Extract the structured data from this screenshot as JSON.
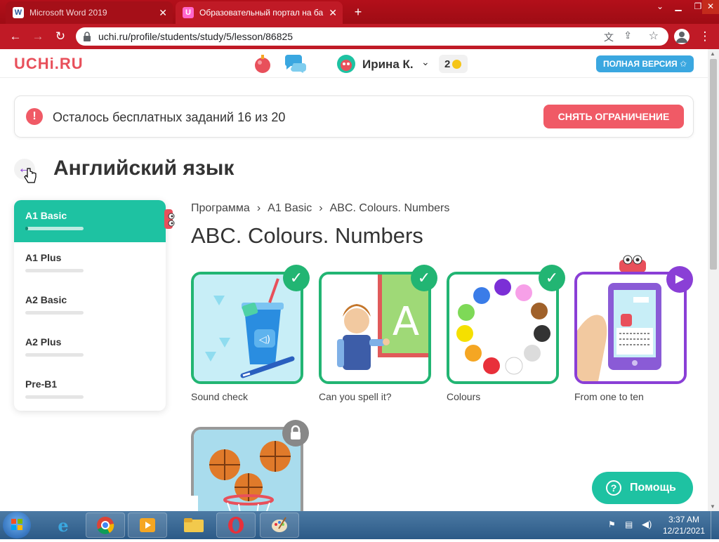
{
  "browser": {
    "tabs": [
      {
        "title": "Microsoft Word 2019",
        "favicon": "W"
      },
      {
        "title": "Образовательный портал на ба",
        "favicon": "U"
      }
    ],
    "url": "uchi.ru/profile/students/study/5/lesson/86825"
  },
  "header": {
    "logo": "UCHi.RU",
    "user_name": "Ирина К.",
    "coins": "2",
    "full_version": "ПОЛНАЯ ВЕРСИЯ ✩"
  },
  "banner": {
    "text": "Осталось бесплатных заданий 16 из 20",
    "button": "СНЯТЬ ОГРАНИЧЕНИЕ"
  },
  "subject_title": "Английский язык",
  "levels": [
    {
      "label": "A1 Basic",
      "active": true,
      "progress": 0.02
    },
    {
      "label": "A1 Plus",
      "active": false,
      "progress": 0
    },
    {
      "label": "A2 Basic",
      "active": false,
      "progress": 0
    },
    {
      "label": "A2 Plus",
      "active": false,
      "progress": 0
    },
    {
      "label": "Pre-B1",
      "active": false,
      "progress": 0
    }
  ],
  "breadcrumb": [
    "Программа",
    "A1 Basic",
    "ABC. Colours. Numbers"
  ],
  "breadcrumb_sep": "›",
  "lesson_title": "ABC. Colours. Numbers",
  "lessons": [
    {
      "caption": "Sound check",
      "status": "completed"
    },
    {
      "caption": "Can you spell it?",
      "status": "completed"
    },
    {
      "caption": "Colours",
      "status": "completed"
    },
    {
      "caption": "From one to ten",
      "status": "current"
    },
    {
      "caption": "",
      "status": "locked"
    }
  ],
  "colours": {
    "accent": "#1ec2a2",
    "brand": "#e8505b",
    "completed": "#22b573",
    "current": "#8a3fd6",
    "locked": "#999999"
  },
  "help_button": "Помощь",
  "taskbar": {
    "time": "3:37 AM",
    "date": "12/21/2021"
  }
}
